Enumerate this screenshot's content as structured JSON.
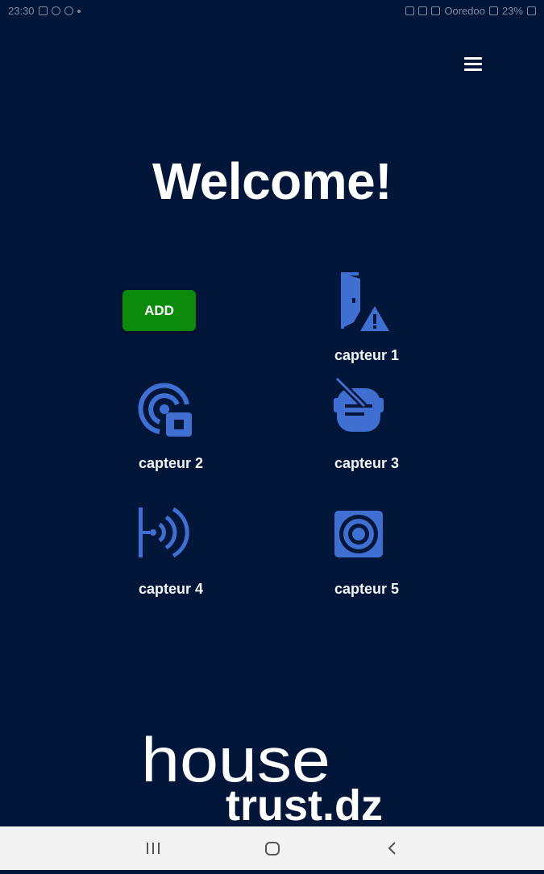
{
  "status_bar": {
    "time": "23:30",
    "right_text": "Ooredoo",
    "battery_percent": "23%",
    "left_icons": [
      "gallery-icon",
      "messenger-icon",
      "chrome-icon",
      "dot-icon"
    ],
    "right_icons": [
      "alarm-icon",
      "nfc-icon",
      "mute-icon",
      "signal-icon",
      "battery-icon"
    ]
  },
  "header": {
    "menu_icon": "hamburger-menu-icon"
  },
  "welcome": {
    "title": "Welcome!"
  },
  "actions": {
    "add_label": "ADD"
  },
  "sensors": [
    {
      "label": "capteur 1",
      "icon": "door-warning-icon"
    },
    {
      "label": "capteur 2",
      "icon": "radar-lock-icon"
    },
    {
      "label": "capteur 3",
      "icon": "cancelled-gear-icon"
    },
    {
      "label": "capteur 4",
      "icon": "signal-waves-icon"
    },
    {
      "label": "capteur 5",
      "icon": "target-square-icon"
    }
  ],
  "logo": {
    "line1": "house",
    "line2": "trust.dz"
  },
  "nav_bar": {
    "icons": [
      "recent-apps-icon",
      "home-icon",
      "back-icon"
    ]
  },
  "colors": {
    "background": "#02163a",
    "accent_icon": "#3f6fd1",
    "add_button": "#0b8a0b",
    "text": "#ffffff",
    "nav_bar": "#f3f3f3"
  }
}
